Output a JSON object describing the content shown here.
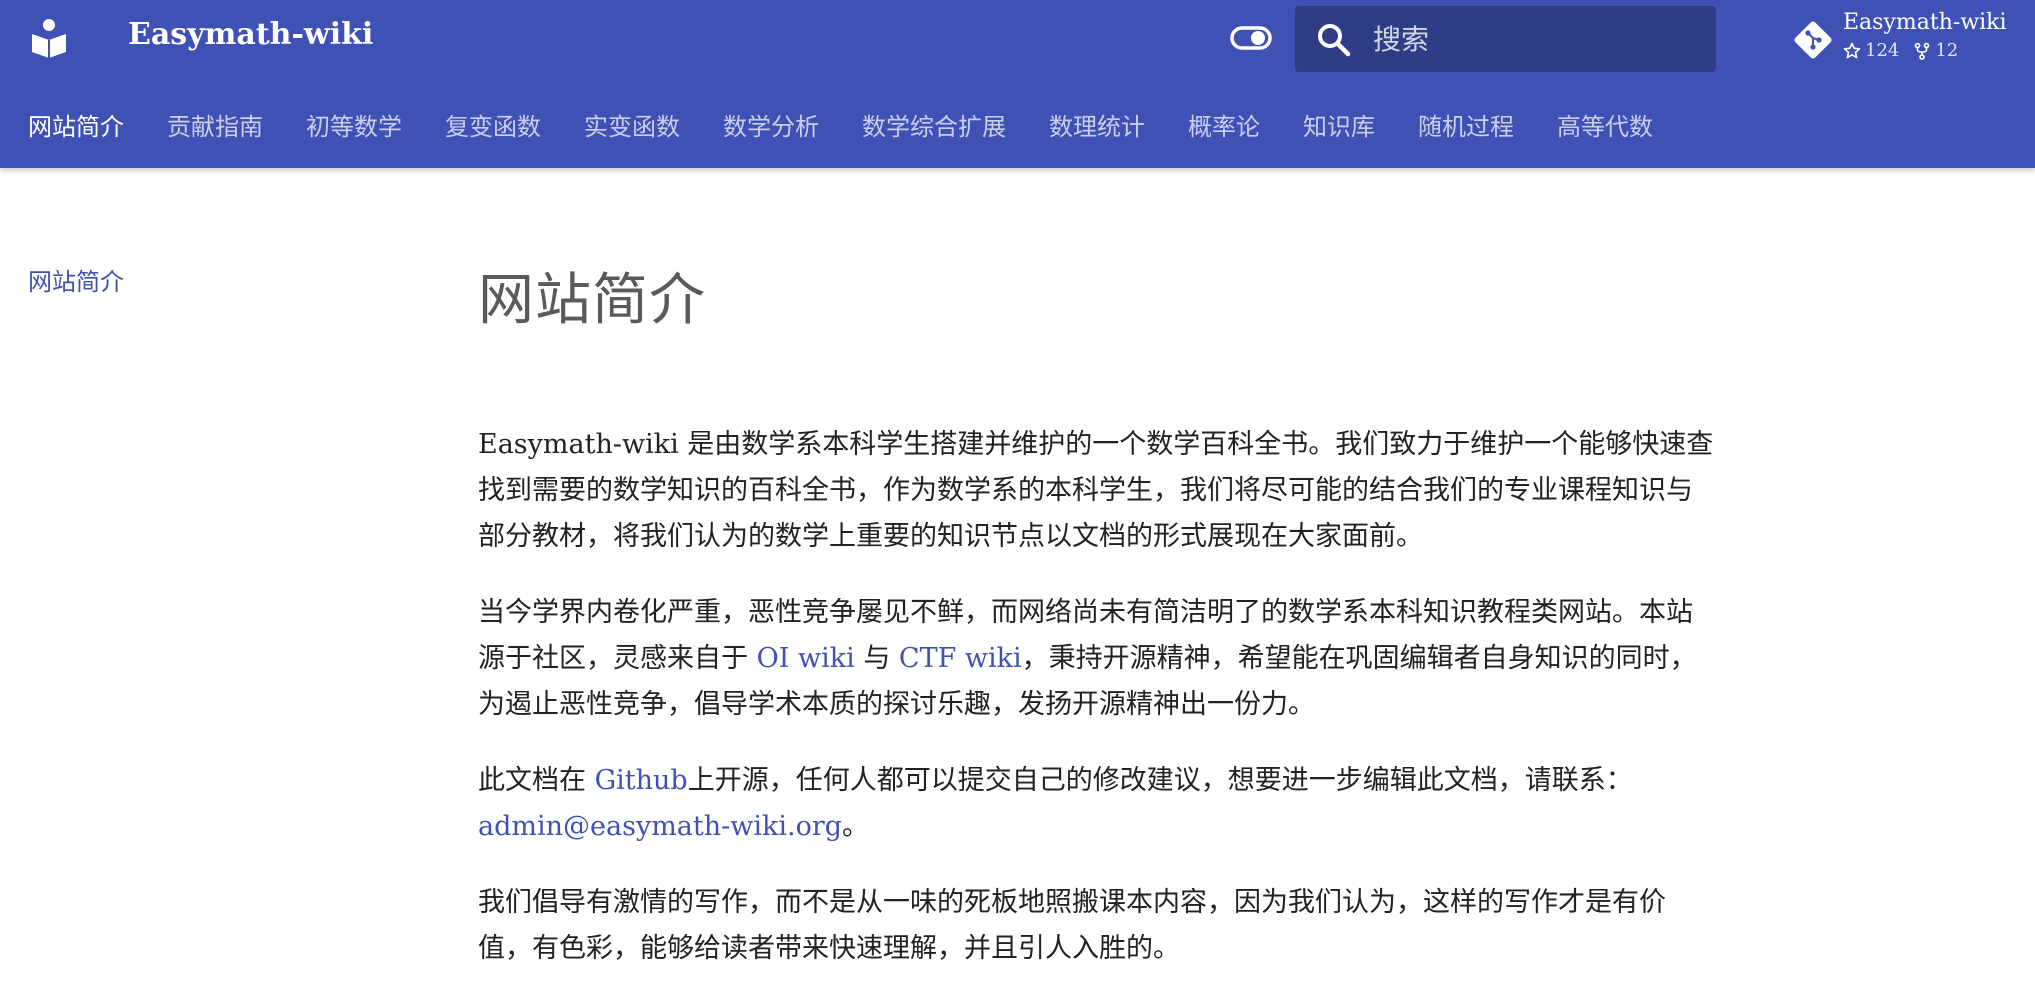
{
  "header": {
    "site_title": "Easymath-wiki",
    "search_placeholder": "搜索",
    "repo": {
      "name": "Easymath-wiki",
      "stars": "124",
      "forks": "12"
    },
    "colors": {
      "primary": "#4051b5",
      "text_on_primary": "#ffffff"
    }
  },
  "tabs": [
    {
      "label": "网站简介",
      "active": true
    },
    {
      "label": "贡献指南"
    },
    {
      "label": "初等数学"
    },
    {
      "label": "复变函数"
    },
    {
      "label": "实变函数"
    },
    {
      "label": "数学分析"
    },
    {
      "label": "数学综合扩展"
    },
    {
      "label": "数理统计"
    },
    {
      "label": "概率论"
    },
    {
      "label": "知识库"
    },
    {
      "label": "随机过程"
    },
    {
      "label": "高等代数"
    }
  ],
  "sidebar": {
    "items": [
      {
        "label": "网站简介"
      }
    ]
  },
  "content": {
    "title": "网站简介",
    "p1": "Easymath-wiki 是由数学系本科学生搭建并维护的一个数学百科全书。我们致力于维护一个能够快速查找到需要的数学知识的百科全书，作为数学系的本科学生，我们将尽可能的结合我们的专业课程知识与部分教材，将我们认为的数学上重要的知识节点以文档的形式展现在大家面前。",
    "p2": {
      "before": "当今学界内卷化严重，恶性竞争屡见不鲜，而网络尚未有简洁明了的数学系本科知识教程类网站。本站源于社区，灵感来自于 ",
      "link1": "OI wiki",
      "middle": " 与 ",
      "link2": "CTF wiki",
      "after": "，秉持开源精神，希望能在巩固编辑者自身知识的同时，为遏止恶性竞争，倡导学术本质的探讨乐趣，发扬开源精神出一份力。"
    },
    "p3": {
      "before": "此文档在 ",
      "link1": "Github",
      "middle": "上开源，任何人都可以提交自己的修改建议，想要进一步编辑此文档，请联系：",
      "link2": "admin@easymath-wiki.org",
      "after": "。"
    },
    "p4": "我们倡导有激情的写作，而不是从一味的死板地照搬课本内容，因为我们认为，这样的写作才是有价值，有色彩，能够给读者带来快速理解，并且引人入胜的。"
  },
  "icons": {
    "logo": "book-reader-icon",
    "toggle": "toggle-theme-icon",
    "search": "search-icon",
    "repo": "git-icon",
    "star": "star-icon",
    "fork": "fork-icon"
  }
}
